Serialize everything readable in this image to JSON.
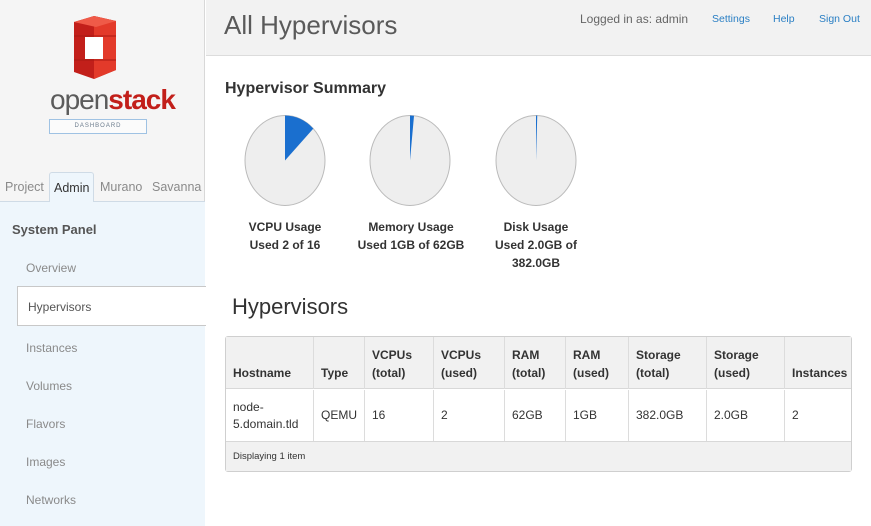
{
  "brand": {
    "word_part1": "open",
    "word_part2": "stack",
    "subtitle": "DASHBOARD",
    "colors": {
      "red": "#c21f1a",
      "gray": "#5b5b5b"
    }
  },
  "tabs": [
    {
      "label": "Project",
      "active": false
    },
    {
      "label": "Admin",
      "active": true
    },
    {
      "label": "Murano",
      "active": false
    },
    {
      "label": "Savanna",
      "active": false
    }
  ],
  "panel": {
    "title": "System Panel",
    "items": [
      "Overview",
      "Hypervisors",
      "Instances",
      "Volumes",
      "Flavors",
      "Images",
      "Networks"
    ],
    "active_item": "Hypervisors"
  },
  "header": {
    "title": "All Hypervisors",
    "logged_in": "Logged in as: admin",
    "links": [
      "Settings",
      "Help",
      "Sign Out"
    ]
  },
  "summary": {
    "title": "Hypervisor Summary",
    "charts": [
      {
        "label": "VCPU Usage",
        "sub1": "Used 2 of 16",
        "sub2": "",
        "fraction": 0.125,
        "icon": "pie-chart-icon"
      },
      {
        "label": "Memory Usage",
        "sub1": "Used 1GB of 62GB",
        "sub2": "",
        "fraction": 0.016,
        "icon": "pie-chart-icon"
      },
      {
        "label": "Disk Usage",
        "sub1": "Used 2.0GB of",
        "sub2": "382.0GB",
        "fraction": 0.005,
        "icon": "pie-chart-icon"
      }
    ],
    "colors": {
      "used": "#1a6fcf",
      "free": "#eeeeee",
      "border": "#bbbbbb"
    }
  },
  "hypervisors": {
    "title": "Hypervisors",
    "columns": [
      {
        "l1": "",
        "l2": "Hostname"
      },
      {
        "l1": "",
        "l2": "Type"
      },
      {
        "l1": "VCPUs",
        "l2": "(total)"
      },
      {
        "l1": "VCPUs",
        "l2": "(used)"
      },
      {
        "l1": "RAM",
        "l2": "(total)"
      },
      {
        "l1": "RAM",
        "l2": "(used)"
      },
      {
        "l1": "Storage",
        "l2": "(total)"
      },
      {
        "l1": "Storage",
        "l2": "(used)"
      },
      {
        "l1": "",
        "l2": "Instances"
      }
    ],
    "rows": [
      {
        "host1": "node-",
        "host2": "5.domain.tld",
        "type": "QEMU",
        "vcpus_total": "16",
        "vcpus_used": "2",
        "ram_total": "62GB",
        "ram_used": "1GB",
        "storage_total": "382.0GB",
        "storage_used": "2.0GB",
        "instances": "2"
      }
    ],
    "footer": "Displaying 1 item"
  }
}
